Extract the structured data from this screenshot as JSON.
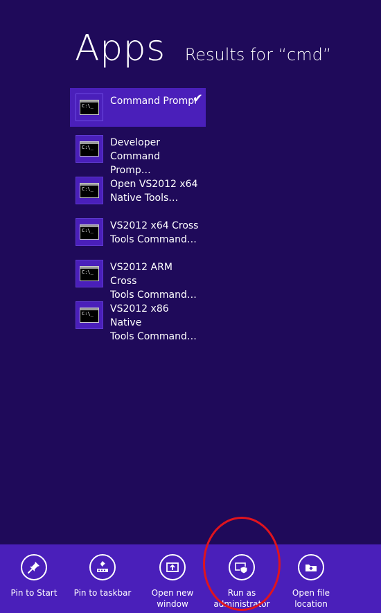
{
  "header": {
    "title": "Apps",
    "subtitle": "Results for “cmd”"
  },
  "results": [
    {
      "label": "Command Prompt",
      "selected": true,
      "icon": "console-icon"
    },
    {
      "label": "Developer\nCommand Promp…",
      "selected": false,
      "icon": "console-icon"
    },
    {
      "label": "Open VS2012 x64\nNative Tools…",
      "selected": false,
      "icon": "console-icon"
    },
    {
      "label": "VS2012 x64 Cross\nTools Command…",
      "selected": false,
      "icon": "console-icon"
    },
    {
      "label": "VS2012 ARM Cross\nTools Command…",
      "selected": false,
      "icon": "console-icon"
    },
    {
      "label": "VS2012 x86 Native\nTools Command…",
      "selected": false,
      "icon": "console-icon"
    }
  ],
  "console_icon_text": "C:\\_",
  "appbar": {
    "commands": [
      {
        "label": "Pin to Start",
        "icon": "pin-icon"
      },
      {
        "label": "Pin to taskbar",
        "icon": "pin-taskbar-icon"
      },
      {
        "label": "Open new\nwindow",
        "icon": "new-window-icon"
      },
      {
        "label": "Run as\nadministrator",
        "icon": "shield-admin-icon"
      },
      {
        "label": "Open file\nlocation",
        "icon": "folder-location-icon"
      }
    ]
  },
  "colors": {
    "background": "#1f0a5a",
    "accent": "#4a1fba",
    "annotation": "#e0141e"
  }
}
